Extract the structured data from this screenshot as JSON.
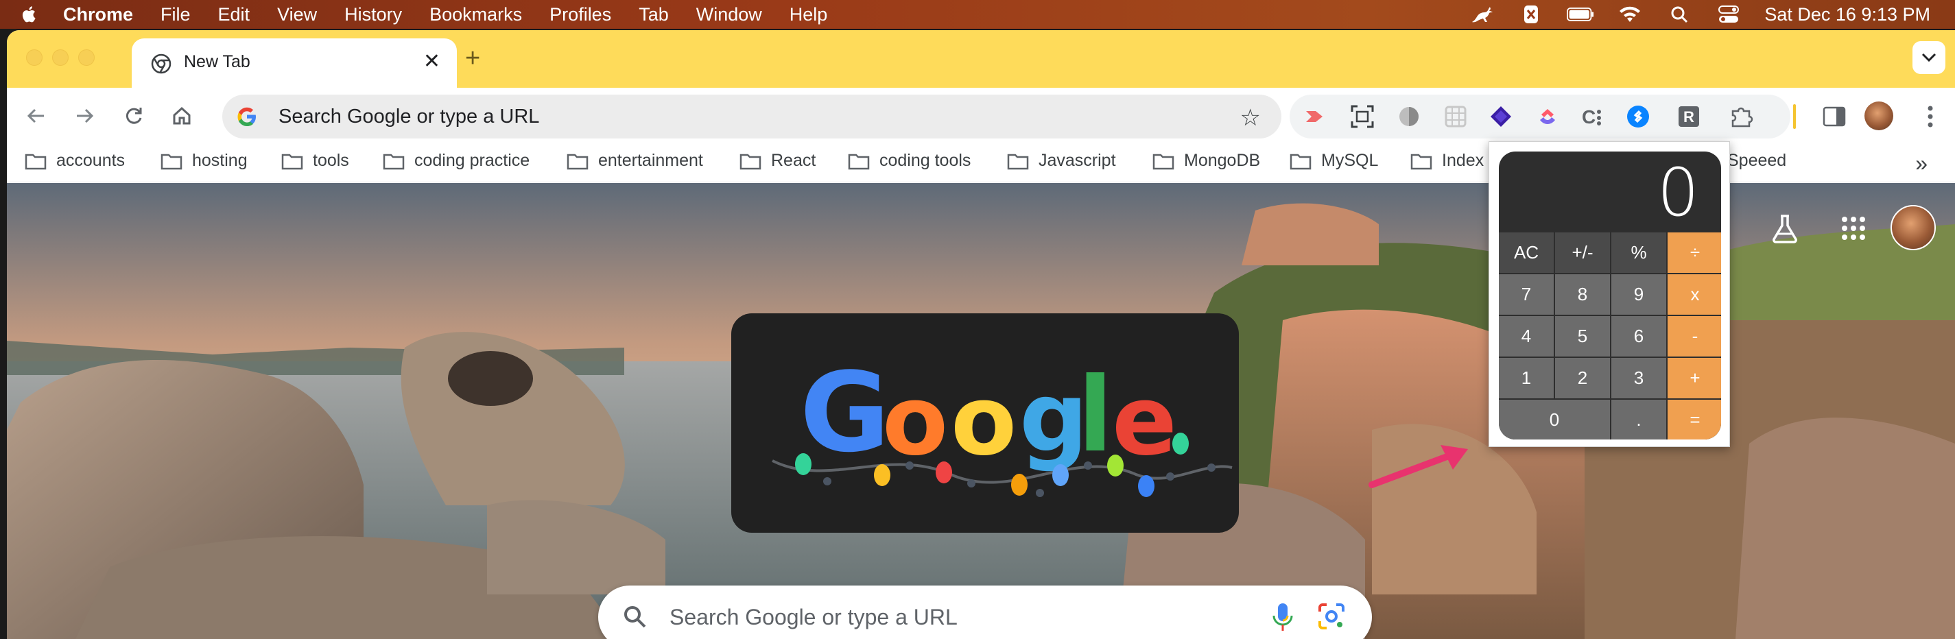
{
  "menubar": {
    "items": [
      "Chrome",
      "File",
      "Edit",
      "View",
      "History",
      "Bookmarks",
      "Profiles",
      "Tab",
      "Window",
      "Help"
    ],
    "clock": "Sat Dec 16  9:13 PM"
  },
  "tab": {
    "title": "New Tab",
    "close": "✕"
  },
  "newtab": "+",
  "omnibox": {
    "placeholder": "Search Google or type a URL"
  },
  "bookmarks": [
    "accounts",
    "hosting",
    "tools",
    "coding practice",
    "entertainment",
    "React",
    "coding tools",
    "Javascript",
    "MongoDB",
    "MySQL",
    "Index",
    "Speeed"
  ],
  "search": {
    "placeholder": "Search Google or type a URL"
  },
  "calculator": {
    "display": "0",
    "keys": [
      {
        "label": "AC",
        "kind": "fn"
      },
      {
        "label": "+/-",
        "kind": "fn"
      },
      {
        "label": "%",
        "kind": "fn"
      },
      {
        "label": "÷",
        "kind": "op"
      },
      {
        "label": "7",
        "kind": "num"
      },
      {
        "label": "8",
        "kind": "num"
      },
      {
        "label": "9",
        "kind": "num"
      },
      {
        "label": "x",
        "kind": "op"
      },
      {
        "label": "4",
        "kind": "num"
      },
      {
        "label": "5",
        "kind": "num"
      },
      {
        "label": "6",
        "kind": "num"
      },
      {
        "label": "-",
        "kind": "op"
      },
      {
        "label": "1",
        "kind": "num"
      },
      {
        "label": "2",
        "kind": "num"
      },
      {
        "label": "3",
        "kind": "num"
      },
      {
        "label": "+",
        "kind": "op"
      },
      {
        "label": "0",
        "kind": "num"
      },
      {
        "label": ".",
        "kind": "num"
      },
      {
        "label": "=",
        "kind": "op"
      }
    ]
  },
  "doodle": {
    "letters": [
      "G",
      "o",
      "o",
      "g",
      "l",
      "e"
    ]
  },
  "colors": {
    "tabstrip": "#fedb5a",
    "calc_operator": "#f0a050",
    "arrow": "#e8336e"
  }
}
